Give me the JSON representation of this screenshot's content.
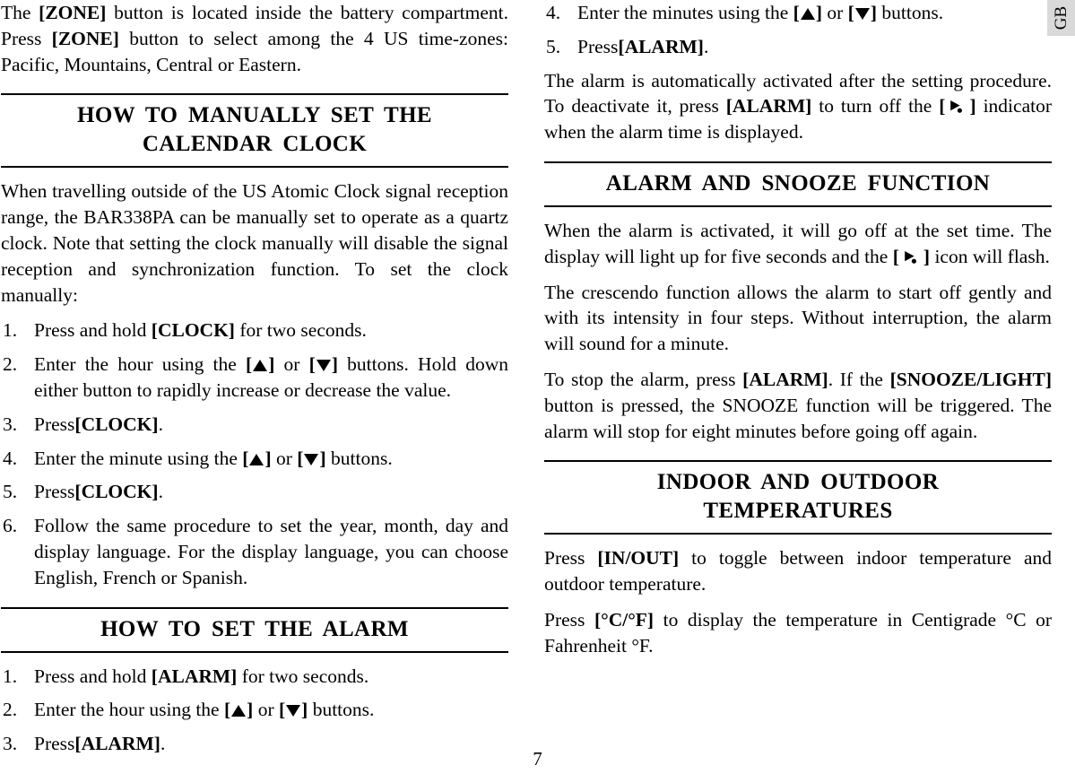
{
  "page": {
    "number": "7",
    "language_tab": "GB"
  },
  "glyphs": {
    "up_button": "[ ▲ ]",
    "down_button": "[ ▼ ]",
    "alarm_indicator": "[ bell ]"
  },
  "left_column": {
    "intro_paragraph": {
      "part1": "The ",
      "bold1": "[ZONE]",
      "part2": " button is located inside the battery compartment. Press ",
      "bold2": "[ZONE]",
      "part3": " button to select among the 4 US time-zones: Pacific, Mountains, Central or Eastern."
    },
    "section_calendar": {
      "heading_line1": "HOW TO MANUALLY SET THE",
      "heading_line2": "CALENDAR CLOCK",
      "intro": "When travelling outside of the US Atomic Clock signal reception range, the BAR338PA can be manually set to operate as a quartz clock.  Note that setting the clock manually will disable the signal reception and synchronization function.  To set the clock manually:",
      "steps": [
        {
          "num": "1.",
          "text_before": "Press and hold ",
          "bold": "[CLOCK]",
          "text_after": " for two seconds."
        },
        {
          "num": "2.",
          "text_before": "Enter the hour using the ",
          "icon_up": "[ ▲ ]",
          "text_mid": " or ",
          "icon_down": "[ ▼ ]",
          "text_after": " buttons. Hold down either button to rapidly increase or decrease the value."
        },
        {
          "num": "3.",
          "text_before": "Press",
          "bold": "[CLOCK]",
          "text_after": "."
        },
        {
          "num": "4.",
          "text_before": "Enter the minute using the ",
          "icon_up": "[ ▲ ]",
          "text_mid": " or ",
          "icon_down": "[ ▼ ]",
          "text_after": " buttons."
        },
        {
          "num": "5.",
          "text_before": "Press",
          "bold": "[CLOCK]",
          "text_after": "."
        },
        {
          "num": "6.",
          "text_before": "Follow the same procedure to set the year, month, day and display language. For the display language, you can choose English, French or Spanish.",
          "bold": "",
          "text_after": ""
        }
      ]
    },
    "section_alarm": {
      "heading": "HOW TO SET THE ALARM",
      "steps": [
        {
          "num": "1.",
          "text_before": "Press and hold  ",
          "bold": "[ALARM]",
          "text_after": " for two seconds."
        },
        {
          "num": "2.",
          "text_before": "Enter the hour using the ",
          "icon_up": "[ ▲ ]",
          "text_mid": " or ",
          "icon_down": "[ ▼ ]",
          "text_after": " buttons."
        },
        {
          "num": "3.",
          "text_before": "Press",
          "bold": "[ALARM]",
          "text_after": "."
        }
      ]
    }
  },
  "right_column": {
    "alarm_steps_continued": [
      {
        "num": "4.",
        "text_before": "Enter the minutes using the ",
        "icon_up": "[ ▲ ]",
        "text_mid": " or ",
        "icon_down": "[ ▼ ]",
        "text_after": " buttons."
      },
      {
        "num": "5.",
        "text_before": "Press",
        "bold": "[ALARM]",
        "text_after": "."
      }
    ],
    "alarm_note": {
      "part1": "The alarm is automatically activated after the setting procedure. To deactivate it, press ",
      "bold1": "[ALARM]",
      "part2": " to turn off the ",
      "bracket_open": "[",
      "bracket_close": "]",
      "part3": " indicator when the alarm time is displayed."
    },
    "section_snooze": {
      "heading": "ALARM AND SNOOZE FUNCTION",
      "para1": {
        "part1": "When the alarm is activated, it will go off at the set time. The display will light up for five seconds and the ",
        "bracket_open": "[",
        "bracket_close": "]",
        "part2": " icon will flash."
      },
      "para2": "The crescendo function allows the alarm to start off gently and with its intensity in four steps. Without interruption, the alarm will sound for a minute.",
      "para3": {
        "part1": "To stop the alarm, press ",
        "bold1": "[ALARM]",
        "part2": ". If the ",
        "bold2": "[SNOOZE/LIGHT]",
        "part3": " button is pressed, the SNOOZE function will be triggered. The alarm will stop for eight minutes before going off again."
      }
    },
    "section_temperature": {
      "heading_line1": "INDOOR AND OUTDOOR",
      "heading_line2": "TEMPERATURES",
      "para1": {
        "part1": "Press ",
        "bold1": "[IN/OUT]",
        "part2": " to toggle between indoor temperature and outdoor temperature."
      },
      "para2": {
        "part1": "Press ",
        "bold1": "[°C/°F]",
        "part2": " to display the temperature in Centigrade °C or Fahrenheit °F."
      }
    }
  }
}
